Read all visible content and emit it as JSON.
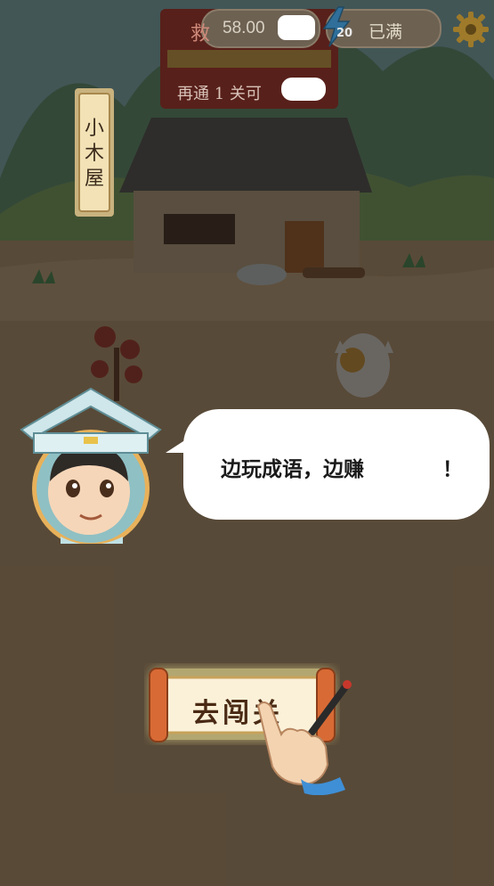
{
  "hud": {
    "coins": "58.00",
    "energy_count": "20",
    "energy_status": "已满"
  },
  "banner": {
    "title_partial": "救",
    "subtitle": "再通 1 关可"
  },
  "location_sign": "小木屋",
  "speech": {
    "text": "边玩成语，边赚",
    "end": "！"
  },
  "go_button_label": "去闯关",
  "icons": {
    "settings": "gear-icon",
    "energy": "lightning-bolt-icon",
    "tap_hint": "pointing-hand-icon"
  },
  "colors": {
    "overlay": "#141210",
    "banner_red": "#c8372b",
    "scroll_paper": "#fbf1d9",
    "scroll_rod": "#d86a35",
    "glow": "#fff3a0"
  }
}
